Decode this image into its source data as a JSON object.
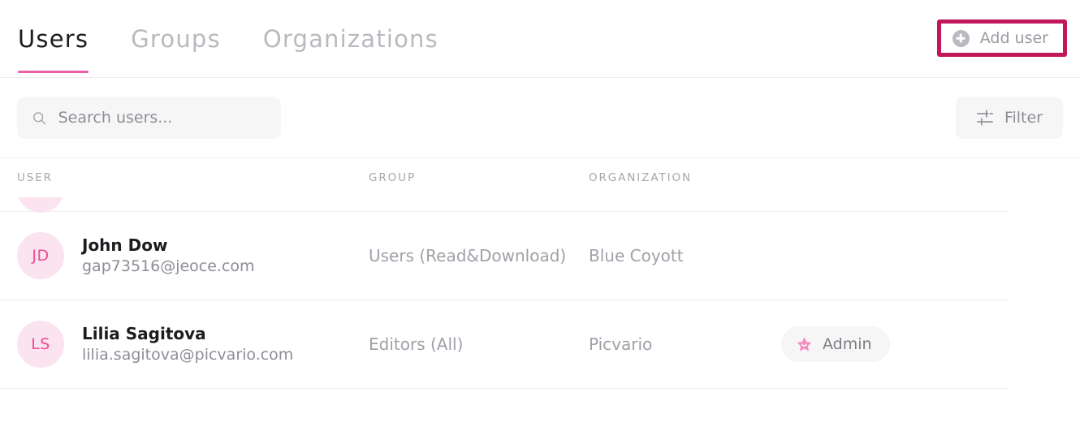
{
  "tabs": [
    {
      "label": "Users",
      "active": true
    },
    {
      "label": "Groups",
      "active": false
    },
    {
      "label": "Organizations",
      "active": false
    }
  ],
  "header": {
    "add_user_label": "Add user",
    "add_user_icon": "plus-circle-icon",
    "annotation_color": "#c2185b"
  },
  "toolbar": {
    "search_placeholder": "Search users...",
    "search_value": "",
    "search_icon": "search-icon",
    "filter_label": "Filter",
    "filter_icon": "sliders-icon"
  },
  "table": {
    "columns": [
      "USER",
      "GROUP",
      "ORGANIZATION"
    ],
    "clipped_row": {
      "initials": "",
      "name": "",
      "email": ""
    },
    "rows": [
      {
        "initials": "JD",
        "name": "John Dow",
        "email": "gap73516@jeoce.com",
        "group": "Users (Read&Download)",
        "organization": "Blue Coyott",
        "role": ""
      },
      {
        "initials": "LS",
        "name": "Lilia Sagitova",
        "email": "lilia.sagitova@picvario.com",
        "group": "Editors (All)",
        "organization": "Picvario",
        "role": "Admin",
        "role_icon": "star-icon"
      }
    ]
  },
  "colors": {
    "accent_pink": "#ec5fa8",
    "avatar_bg": "#fbe3ef",
    "avatar_text": "#ee4b96",
    "annotation": "#c2185b"
  }
}
